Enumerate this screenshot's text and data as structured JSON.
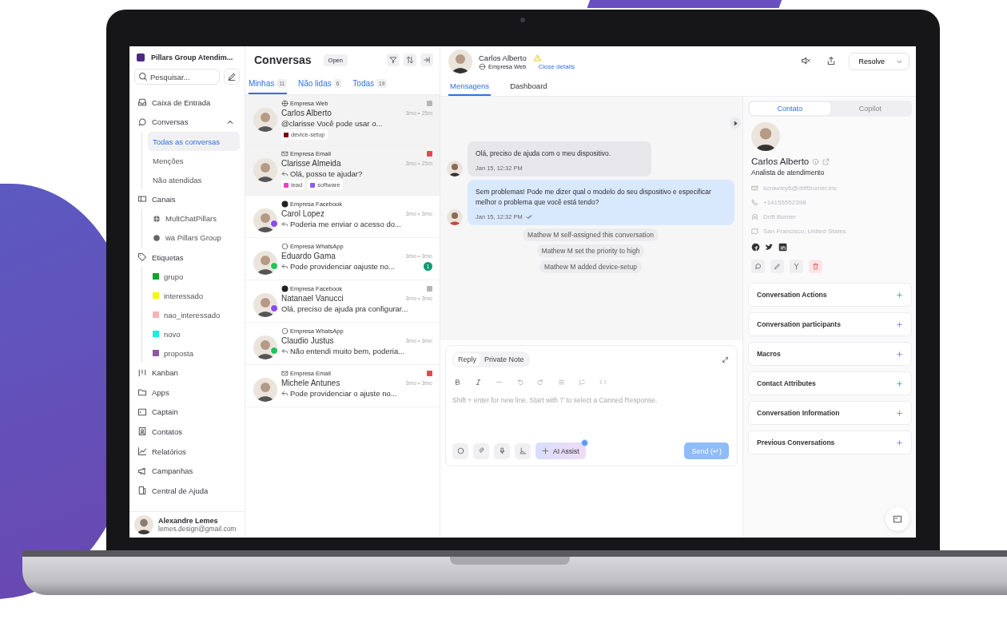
{
  "sidebar": {
    "workspace": "Pillars Group Atendim...",
    "search_placeholder": "Pesquisar...",
    "items": [
      {
        "label": "Caixa de Entrada"
      },
      {
        "label": "Conversas",
        "expanded": true,
        "children": [
          {
            "kind": "view",
            "label": "Todas as conversas",
            "selected": true
          },
          {
            "kind": "view",
            "label": "Menções",
            "selected": false
          },
          {
            "kind": "view",
            "label": "Não atendidas",
            "selected": false
          }
        ]
      },
      {
        "label": "Canais",
        "children": [
          {
            "kind": "channel",
            "label": "MultChatPillars"
          },
          {
            "kind": "channel",
            "label": "wa Pillars Group"
          }
        ]
      },
      {
        "label": "Etiquetas",
        "children": [
          {
            "kind": "label",
            "label": "grupo",
            "color": "#12a62c"
          },
          {
            "kind": "label",
            "label": "interessado",
            "color": "#f5f50a"
          },
          {
            "kind": "label",
            "label": "nao_interessado",
            "color": "#f7b3b3"
          },
          {
            "kind": "label",
            "label": "novo",
            "color": "#14f0e6"
          },
          {
            "kind": "label",
            "label": "proposta",
            "color": "#8e55a8"
          }
        ]
      },
      {
        "label": "Kanban"
      },
      {
        "label": "Apps"
      },
      {
        "label": "Captain"
      },
      {
        "label": "Contatos"
      },
      {
        "label": "Relatórios"
      },
      {
        "label": "Campanhas"
      },
      {
        "label": "Central de Ajuda"
      }
    ],
    "user": {
      "name": "Alexandre Lemes",
      "email": "lemes.design@gmail.com"
    }
  },
  "conversations": {
    "title": "Conversas",
    "status": "Open",
    "tabs": [
      {
        "label": "Minhas",
        "count": "11",
        "selected": true
      },
      {
        "label": "Não lidas",
        "count": "6",
        "selected": false
      },
      {
        "label": "Todas",
        "count": "19",
        "selected": false
      }
    ],
    "items": [
      {
        "kind": "web",
        "inbox": "Empresa Web",
        "name": "Carlos Alberto",
        "time": "3mo • 25m",
        "preview": "@clarisse Você pode usar o...",
        "replied": false,
        "selected": true,
        "priority_flag": {
          "color": "#b5b5bd"
        },
        "tags": [
          {
            "label": "device-setup",
            "color": "#7a0c10"
          }
        ]
      },
      {
        "kind": "email",
        "inbox": "Empresa Email",
        "name": "Clarisse Almeida",
        "time": "3mo • 25m",
        "preview": "Olá, posso te ajudar?",
        "replied": true,
        "selected": true,
        "priority_flag": {
          "color": "#e5484d"
        },
        "tags": [
          {
            "label": "lead",
            "color": "#f03cc8"
          },
          {
            "label": "software",
            "color": "#8a5cf5"
          }
        ]
      },
      {
        "kind": "facebook",
        "inbox": "Empresa Facebook",
        "name": "Carol Lopez",
        "time": "3mo • 3mo",
        "preview": "Poderia me enviar o acesso do...",
        "replied": true,
        "selected": false
      },
      {
        "kind": "whatsapp",
        "inbox": "Empresa WhatsApp",
        "name": "Eduardo Gama",
        "time": "3mo • 3mo",
        "preview": "Pode providenciar oajuste no...",
        "replied": true,
        "selected": false,
        "unread": "1"
      },
      {
        "kind": "facebook",
        "inbox": "Empresa Facebook",
        "name": "Natanael Vanucci",
        "time": "3mo • 3mo",
        "preview": "Olá, preciso de ajuda pra configurar...",
        "replied": false,
        "selected": false,
        "priority_flag": {
          "color": "#b5b5bd"
        }
      },
      {
        "kind": "whatsapp",
        "inbox": "Empresa WhatsApp",
        "name": "Claudio Justus",
        "time": "3mo • 3mo",
        "preview": "Não entendi muito bem, poderia...",
        "replied": true,
        "selected": false
      },
      {
        "kind": "email",
        "inbox": "Empresa Email",
        "name": "Michele Antunes",
        "time": "3mo • 3mo",
        "preview": "Pode providenciar o ajuste no...",
        "replied": true,
        "selected": false,
        "priority_flag": {
          "color": "#e5484d"
        }
      }
    ]
  },
  "chat": {
    "name": "Carlos Alberto",
    "inbox": "Empresa Web",
    "link": "Close details",
    "resolve": "Resolve",
    "tabs": [
      {
        "label": "Mensagens",
        "selected": true
      },
      {
        "label": "Dashboard",
        "selected": false
      }
    ],
    "messages": [
      {
        "kind": "incoming",
        "text": "Olá, preciso de ajuda com o meu dispositivo.",
        "time": "Jan 15, 12:32 PM"
      },
      {
        "kind": "outgoing",
        "text": "Sem problemas! Pode me dizer qual o modelo do seu dispositivo e especificar melhor o problema que você está tendo?",
        "time": "Jan 15, 12:32 PM"
      }
    ],
    "activities": [
      "Mathew M self-assigned this conversation",
      "Mathew M set the priority to high",
      "Mathew M added device-setup"
    ],
    "composer": {
      "modes": [
        {
          "label": "Reply",
          "selected": true
        },
        {
          "label": "Private Note",
          "selected": false
        }
      ],
      "placeholder": "Shift + enter for new line. Start with '/' to select a Canned Response.",
      "ai_assist": "AI Assist",
      "send": "Send (↵)"
    }
  },
  "contact_panel": {
    "tabs": [
      {
        "label": "Contato",
        "selected": true
      },
      {
        "label": "Copilot",
        "selected": false
      }
    ],
    "name": "Carlos Alberto",
    "role": "Analista de atendimento",
    "details": [
      "kcrawley6@driftburner.inc",
      "+14155552398",
      "Drift Burner",
      "San Francisco, United States"
    ],
    "sections": [
      "Conversation Actions",
      "Conversation participants",
      "Macros",
      "Contact Attributes",
      "Conversation Information",
      "Previous Conversations"
    ]
  }
}
